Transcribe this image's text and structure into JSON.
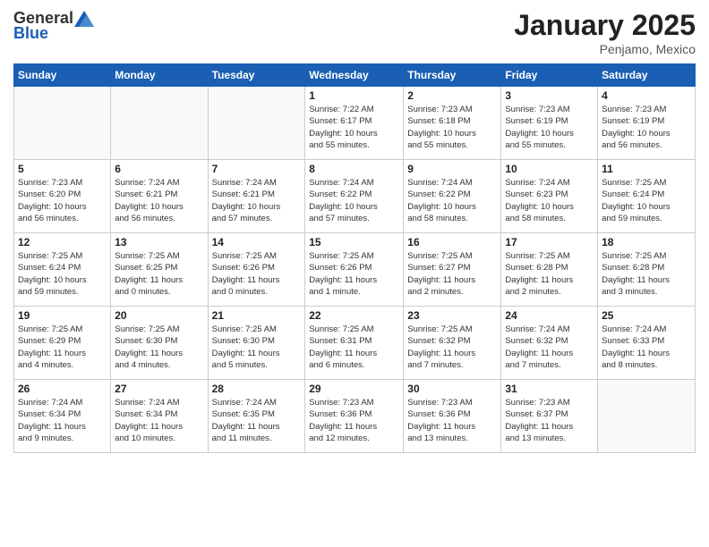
{
  "logo": {
    "general": "General",
    "blue": "Blue"
  },
  "title": "January 2025",
  "subtitle": "Penjamo, Mexico",
  "days_header": [
    "Sunday",
    "Monday",
    "Tuesday",
    "Wednesday",
    "Thursday",
    "Friday",
    "Saturday"
  ],
  "weeks": [
    [
      {
        "day": "",
        "info": ""
      },
      {
        "day": "",
        "info": ""
      },
      {
        "day": "",
        "info": ""
      },
      {
        "day": "1",
        "info": "Sunrise: 7:22 AM\nSunset: 6:17 PM\nDaylight: 10 hours\nand 55 minutes."
      },
      {
        "day": "2",
        "info": "Sunrise: 7:23 AM\nSunset: 6:18 PM\nDaylight: 10 hours\nand 55 minutes."
      },
      {
        "day": "3",
        "info": "Sunrise: 7:23 AM\nSunset: 6:19 PM\nDaylight: 10 hours\nand 55 minutes."
      },
      {
        "day": "4",
        "info": "Sunrise: 7:23 AM\nSunset: 6:19 PM\nDaylight: 10 hours\nand 56 minutes."
      }
    ],
    [
      {
        "day": "5",
        "info": "Sunrise: 7:23 AM\nSunset: 6:20 PM\nDaylight: 10 hours\nand 56 minutes."
      },
      {
        "day": "6",
        "info": "Sunrise: 7:24 AM\nSunset: 6:21 PM\nDaylight: 10 hours\nand 56 minutes."
      },
      {
        "day": "7",
        "info": "Sunrise: 7:24 AM\nSunset: 6:21 PM\nDaylight: 10 hours\nand 57 minutes."
      },
      {
        "day": "8",
        "info": "Sunrise: 7:24 AM\nSunset: 6:22 PM\nDaylight: 10 hours\nand 57 minutes."
      },
      {
        "day": "9",
        "info": "Sunrise: 7:24 AM\nSunset: 6:22 PM\nDaylight: 10 hours\nand 58 minutes."
      },
      {
        "day": "10",
        "info": "Sunrise: 7:24 AM\nSunset: 6:23 PM\nDaylight: 10 hours\nand 58 minutes."
      },
      {
        "day": "11",
        "info": "Sunrise: 7:25 AM\nSunset: 6:24 PM\nDaylight: 10 hours\nand 59 minutes."
      }
    ],
    [
      {
        "day": "12",
        "info": "Sunrise: 7:25 AM\nSunset: 6:24 PM\nDaylight: 10 hours\nand 59 minutes."
      },
      {
        "day": "13",
        "info": "Sunrise: 7:25 AM\nSunset: 6:25 PM\nDaylight: 11 hours\nand 0 minutes."
      },
      {
        "day": "14",
        "info": "Sunrise: 7:25 AM\nSunset: 6:26 PM\nDaylight: 11 hours\nand 0 minutes."
      },
      {
        "day": "15",
        "info": "Sunrise: 7:25 AM\nSunset: 6:26 PM\nDaylight: 11 hours\nand 1 minute."
      },
      {
        "day": "16",
        "info": "Sunrise: 7:25 AM\nSunset: 6:27 PM\nDaylight: 11 hours\nand 2 minutes."
      },
      {
        "day": "17",
        "info": "Sunrise: 7:25 AM\nSunset: 6:28 PM\nDaylight: 11 hours\nand 2 minutes."
      },
      {
        "day": "18",
        "info": "Sunrise: 7:25 AM\nSunset: 6:28 PM\nDaylight: 11 hours\nand 3 minutes."
      }
    ],
    [
      {
        "day": "19",
        "info": "Sunrise: 7:25 AM\nSunset: 6:29 PM\nDaylight: 11 hours\nand 4 minutes."
      },
      {
        "day": "20",
        "info": "Sunrise: 7:25 AM\nSunset: 6:30 PM\nDaylight: 11 hours\nand 4 minutes."
      },
      {
        "day": "21",
        "info": "Sunrise: 7:25 AM\nSunset: 6:30 PM\nDaylight: 11 hours\nand 5 minutes."
      },
      {
        "day": "22",
        "info": "Sunrise: 7:25 AM\nSunset: 6:31 PM\nDaylight: 11 hours\nand 6 minutes."
      },
      {
        "day": "23",
        "info": "Sunrise: 7:25 AM\nSunset: 6:32 PM\nDaylight: 11 hours\nand 7 minutes."
      },
      {
        "day": "24",
        "info": "Sunrise: 7:24 AM\nSunset: 6:32 PM\nDaylight: 11 hours\nand 7 minutes."
      },
      {
        "day": "25",
        "info": "Sunrise: 7:24 AM\nSunset: 6:33 PM\nDaylight: 11 hours\nand 8 minutes."
      }
    ],
    [
      {
        "day": "26",
        "info": "Sunrise: 7:24 AM\nSunset: 6:34 PM\nDaylight: 11 hours\nand 9 minutes."
      },
      {
        "day": "27",
        "info": "Sunrise: 7:24 AM\nSunset: 6:34 PM\nDaylight: 11 hours\nand 10 minutes."
      },
      {
        "day": "28",
        "info": "Sunrise: 7:24 AM\nSunset: 6:35 PM\nDaylight: 11 hours\nand 11 minutes."
      },
      {
        "day": "29",
        "info": "Sunrise: 7:23 AM\nSunset: 6:36 PM\nDaylight: 11 hours\nand 12 minutes."
      },
      {
        "day": "30",
        "info": "Sunrise: 7:23 AM\nSunset: 6:36 PM\nDaylight: 11 hours\nand 13 minutes."
      },
      {
        "day": "31",
        "info": "Sunrise: 7:23 AM\nSunset: 6:37 PM\nDaylight: 11 hours\nand 13 minutes."
      },
      {
        "day": "",
        "info": ""
      }
    ]
  ]
}
